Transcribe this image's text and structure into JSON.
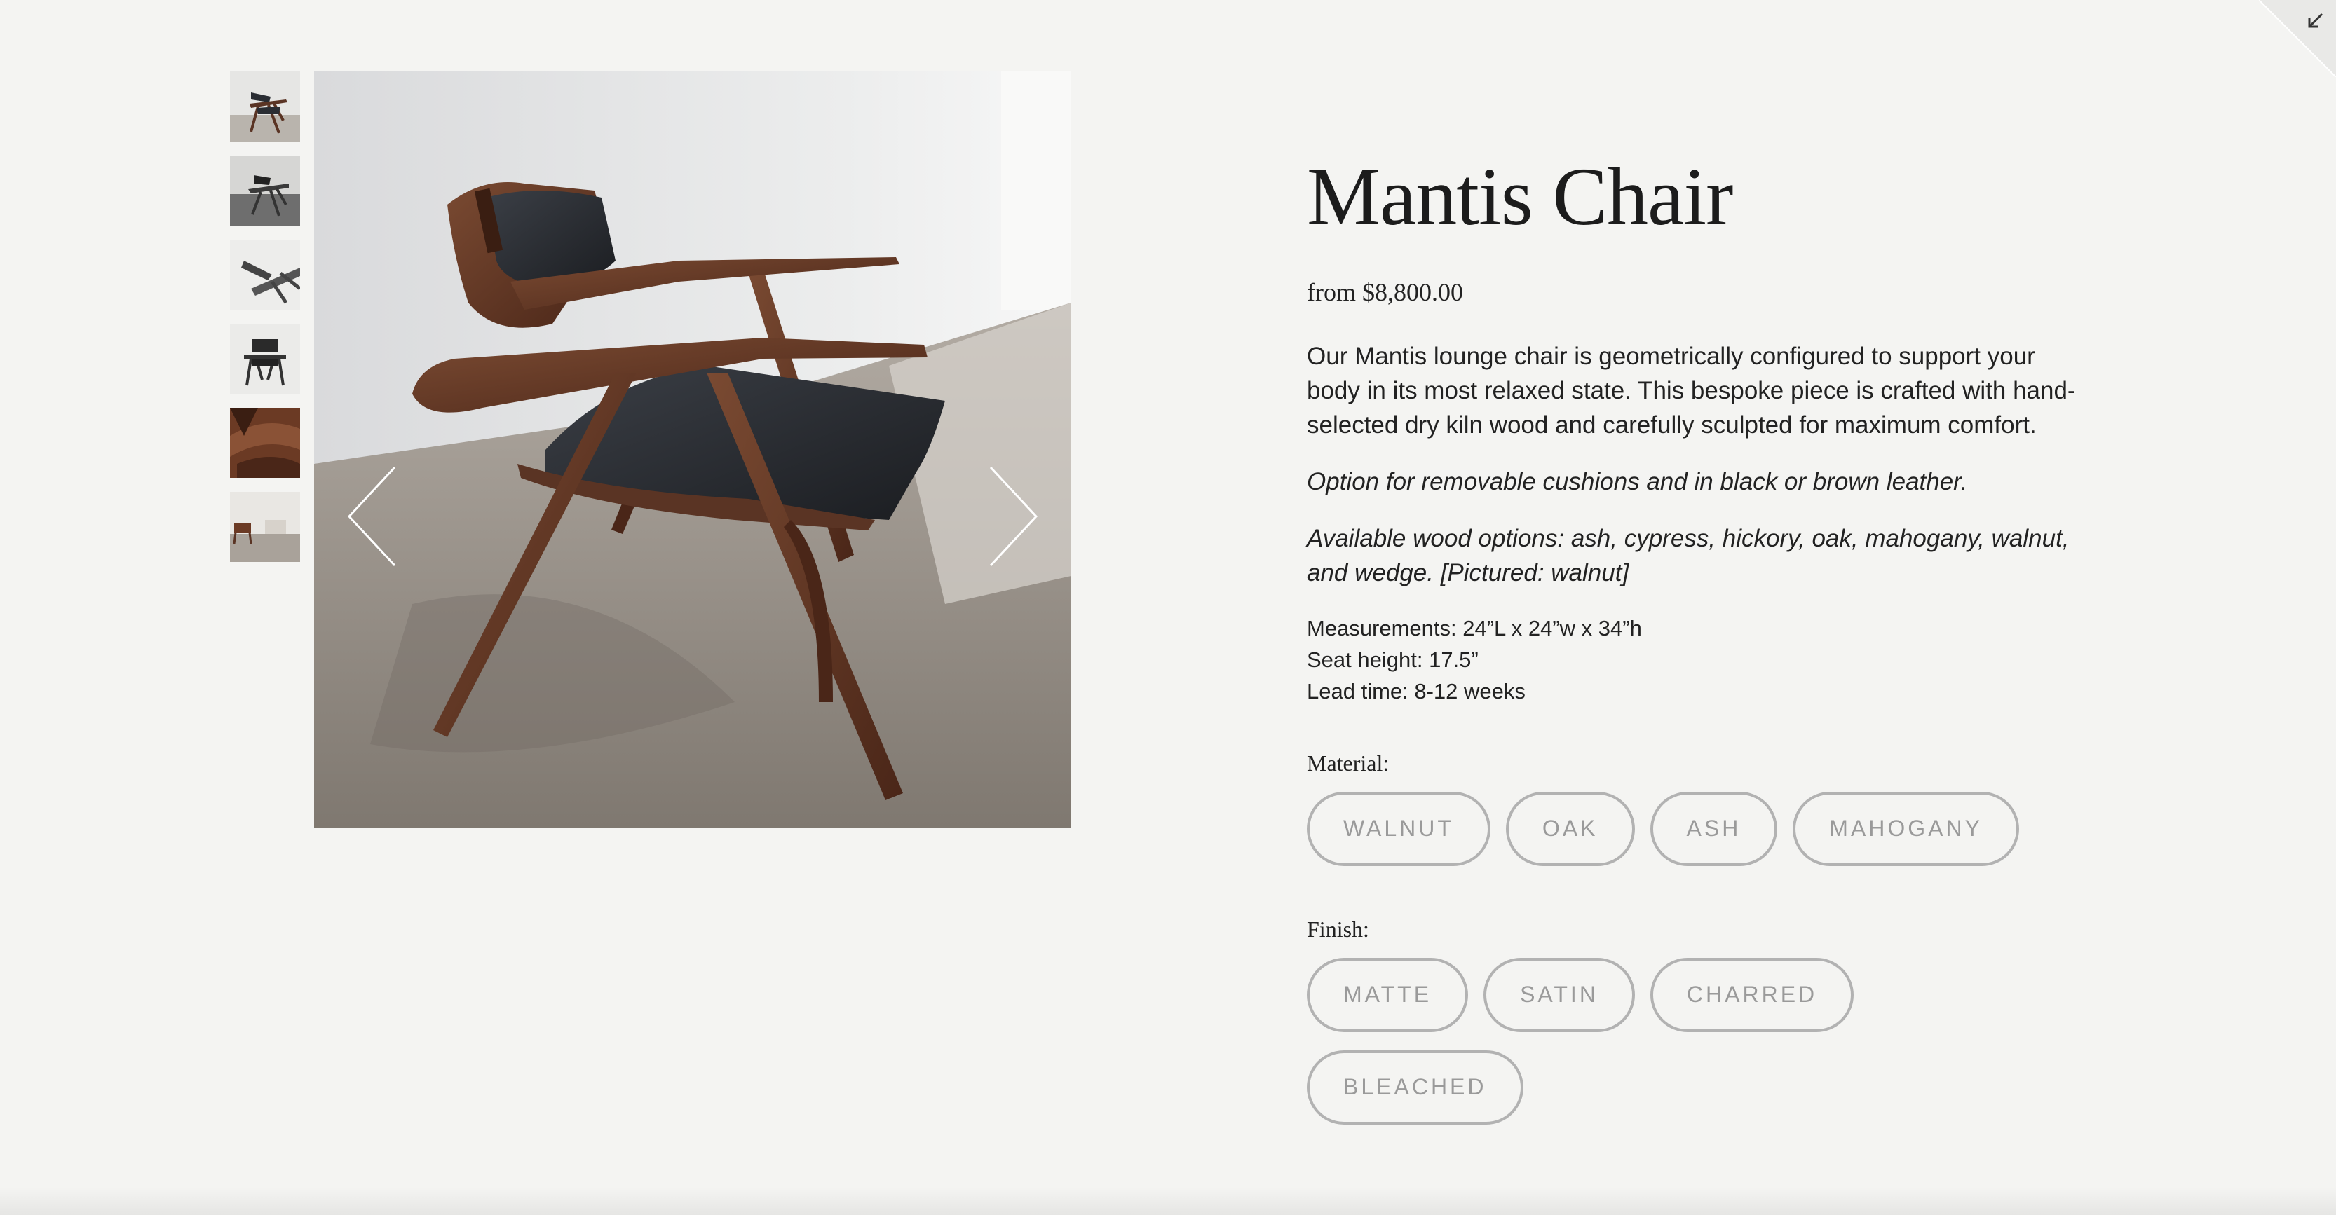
{
  "product": {
    "title": "Mantis Chair",
    "price": "from $8,800.00",
    "description": "Our Mantis lounge chair is geometrically configured to support your body in its most relaxed state. This bespoke piece is crafted with hand-selected dry kiln wood and carefully sculpted for maximum comfort.",
    "options_note": "Option for removable cushions and in black or brown leather.",
    "wood_note": "Available wood options: ash, cypress, hickory, oak, mahogany, walnut, and wedge. [Pictured: walnut]",
    "specs": {
      "measurements": "Measurements: 24”L x 24”w x 34”h",
      "seat_height": "Seat height: 17.5”",
      "lead_time": "Lead time: 8-12 weeks"
    }
  },
  "material": {
    "label": "Material:",
    "options": [
      "WALNUT",
      "OAK",
      "ASH",
      "MAHOGANY"
    ]
  },
  "finish": {
    "label": "Finish:",
    "options": [
      "MATTE",
      "SATIN",
      "CHARRED",
      "BLEACHED"
    ]
  },
  "gallery": {
    "thumbnail_count": 6,
    "icons": {
      "prev": "chevron-left-icon",
      "next": "chevron-right-icon",
      "corner": "collapse-arrow-icon"
    }
  },
  "colors": {
    "background": "#f4f4f2",
    "option_border": "#b2b2b2",
    "option_text": "#9a9a9a",
    "walnut_wood": "#5a3424",
    "leather": "#2a2d33"
  }
}
